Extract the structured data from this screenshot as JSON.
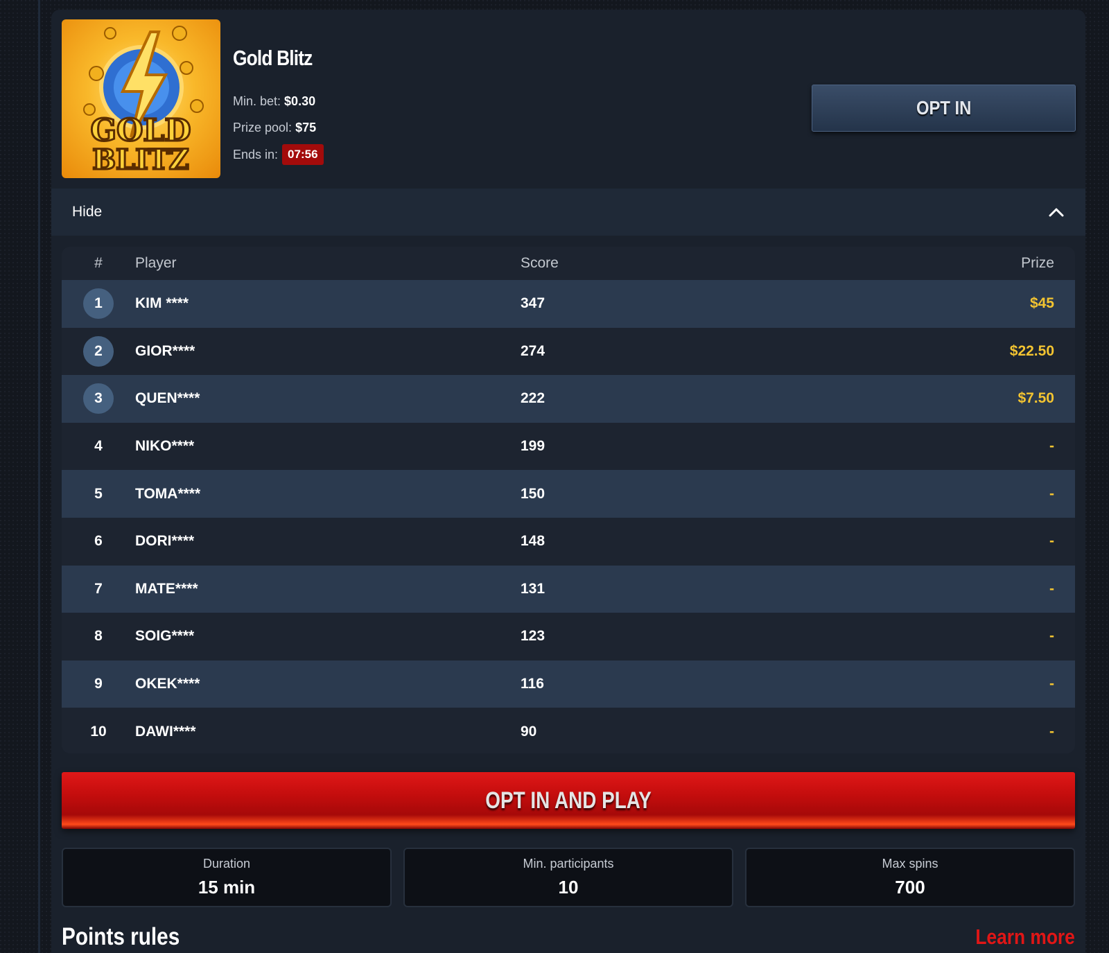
{
  "game": {
    "title": "Gold Blitz",
    "image_alt": "GOLD BLITZ",
    "min_bet_label": "Min. bet:",
    "min_bet_value": "$0.30",
    "prize_pool_label": "Prize pool:",
    "prize_pool_value": "$75",
    "ends_in_label": "Ends in:",
    "ends_in_value": "07:56"
  },
  "buttons": {
    "opt_in": "OPT IN",
    "opt_in_and_play": "OPT IN AND PLAY"
  },
  "collapse": {
    "label": "Hide",
    "icon": "chevron-up-icon"
  },
  "leaderboard": {
    "columns": [
      "#",
      "Player",
      "Score",
      "Prize"
    ],
    "rows": [
      {
        "rank": "1",
        "player": "KIM ****",
        "score": "347",
        "prize": "$45"
      },
      {
        "rank": "2",
        "player": "GIOR****",
        "score": "274",
        "prize": "$22.50"
      },
      {
        "rank": "3",
        "player": "QUEN****",
        "score": "222",
        "prize": "$7.50"
      },
      {
        "rank": "4",
        "player": "NIKO****",
        "score": "199",
        "prize": "-"
      },
      {
        "rank": "5",
        "player": "TOMA****",
        "score": "150",
        "prize": "-"
      },
      {
        "rank": "6",
        "player": "DORI****",
        "score": "148",
        "prize": "-"
      },
      {
        "rank": "7",
        "player": "MATE****",
        "score": "131",
        "prize": "-"
      },
      {
        "rank": "8",
        "player": "SOIG****",
        "score": "123",
        "prize": "-"
      },
      {
        "rank": "9",
        "player": "OKEK****",
        "score": "116",
        "prize": "-"
      },
      {
        "rank": "10",
        "player": "DAWI****",
        "score": "90",
        "prize": "-"
      }
    ]
  },
  "stats": [
    {
      "label": "Duration",
      "value": "15 min"
    },
    {
      "label": "Min. participants",
      "value": "10"
    },
    {
      "label": "Max spins",
      "value": "700"
    }
  ],
  "footer": {
    "points_rules": "Points rules",
    "learn_more": "Learn more"
  },
  "colors": {
    "accent_red": "#e01616",
    "prize_gold": "#f3c431",
    "timer_bg": "#a30b0b"
  }
}
